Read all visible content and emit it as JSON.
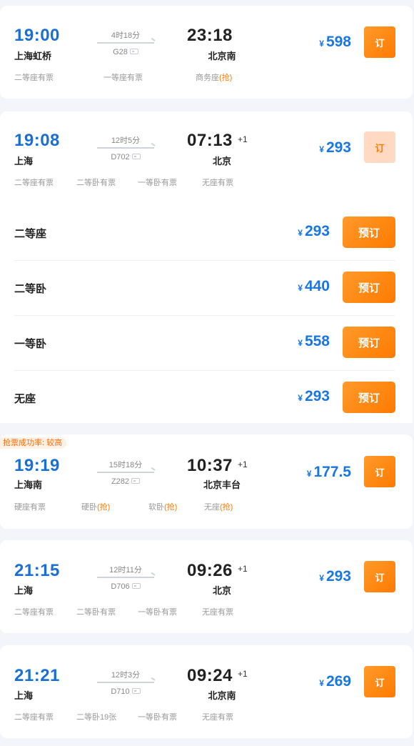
{
  "trains": [
    {
      "dep_time": "19:00",
      "dep_station": "上海虹桥",
      "duration": "4时18分",
      "code": "G28",
      "arr_time": "23:18",
      "arr_station": "北京南",
      "plus": "",
      "price": "598",
      "currency": "¥",
      "book": "订",
      "seats": [
        {
          "name": "二等座有票",
          "grab": ""
        },
        {
          "name": "一等座有票",
          "grab": ""
        },
        {
          "name": "商务座",
          "grab": "(抢)"
        }
      ]
    },
    {
      "dep_time": "19:08",
      "dep_station": "上海",
      "duration": "12时5分",
      "code": "D702",
      "arr_time": "07:13",
      "arr_station": "北京",
      "plus": "+1",
      "price": "293",
      "currency": "¥",
      "book": "订",
      "seats": [
        {
          "name": "二等座有票",
          "grab": ""
        },
        {
          "name": "二等卧有票",
          "grab": ""
        },
        {
          "name": "一等卧有票",
          "grab": ""
        },
        {
          "name": "无座有票",
          "grab": ""
        }
      ]
    },
    {
      "dep_time": "19:19",
      "dep_station": "上海南",
      "duration": "15时18分",
      "code": "Z282",
      "arr_time": "10:37",
      "arr_station": "北京丰台",
      "plus": "+1",
      "price": "177.5",
      "currency": "¥",
      "book": "订",
      "seats": [
        {
          "name": "硬座有票",
          "grab": ""
        },
        {
          "name": "硬卧",
          "grab": "(抢)"
        },
        {
          "name": "软卧",
          "grab": "(抢)"
        },
        {
          "name": "无座",
          "grab": "(抢)"
        }
      ]
    },
    {
      "dep_time": "21:15",
      "dep_station": "上海",
      "duration": "12时11分",
      "code": "D706",
      "arr_time": "09:26",
      "arr_station": "北京",
      "plus": "+1",
      "price": "293",
      "currency": "¥",
      "book": "订",
      "seats": [
        {
          "name": "二等座有票",
          "grab": ""
        },
        {
          "name": "二等卧有票",
          "grab": ""
        },
        {
          "name": "一等卧有票",
          "grab": ""
        },
        {
          "name": "无座有票",
          "grab": ""
        }
      ]
    },
    {
      "dep_time": "21:21",
      "dep_station": "上海",
      "duration": "12时3分",
      "code": "D710",
      "arr_time": "09:24",
      "arr_station": "北京南",
      "plus": "+1",
      "price": "269",
      "currency": "¥",
      "book": "订",
      "seats": [
        {
          "name": "二等座有票",
          "grab": ""
        },
        {
          "name": "二等卧19张",
          "grab": ""
        },
        {
          "name": "一等卧有票",
          "grab": ""
        },
        {
          "name": "无座有票",
          "grab": ""
        }
      ]
    }
  ],
  "expanded_seats": [
    {
      "name": "二等座",
      "price": "293",
      "currency": "¥",
      "book": "预订"
    },
    {
      "name": "二等卧",
      "price": "440",
      "currency": "¥",
      "book": "预订"
    },
    {
      "name": "一等卧",
      "price": "558",
      "currency": "¥",
      "book": "预订"
    },
    {
      "name": "无座",
      "price": "293",
      "currency": "¥",
      "book": "预订"
    }
  ],
  "success_tag": "抢票成功率: 较高",
  "colors": {
    "accent_blue": "#1a76e0",
    "accent_orange": "#ff7a00",
    "page_bg": "#f3f5fa"
  }
}
